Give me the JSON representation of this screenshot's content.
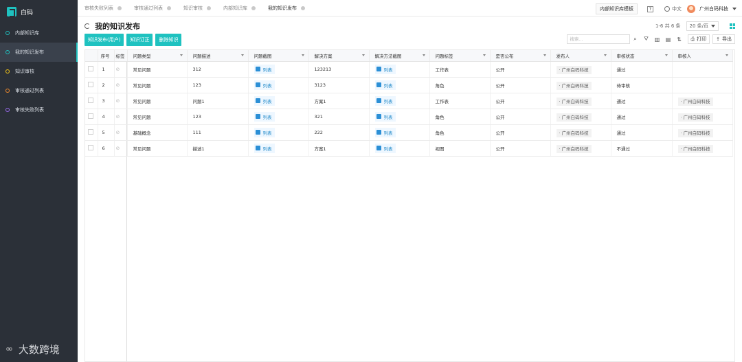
{
  "sidebar": {
    "brand": "白码",
    "items": [
      {
        "label": "内部知识库",
        "color": "#1fc2c0",
        "active": false
      },
      {
        "label": "我的知识发布",
        "color": "#1fc2c0",
        "active": true
      },
      {
        "label": "知识审核",
        "color": "#f5c518",
        "active": false
      },
      {
        "label": "审核通过列表",
        "color": "#f08a2c",
        "active": false
      },
      {
        "label": "审核失败列表",
        "color": "#9b6bf0",
        "active": false
      }
    ],
    "watermark": "大数跨境"
  },
  "tabs": [
    "审核失败列表",
    "审核通过列表",
    "知识审核",
    "内部知识库",
    "我的知识发布"
  ],
  "topbar": {
    "template_btn": "内部知识库模板",
    "help": "?",
    "lang": "中文",
    "company": "广州白码科技"
  },
  "page": {
    "title": "我的知识发布",
    "pager_text": "1-6 共 6 条",
    "page_size": "20 条/页"
  },
  "actions": [
    "知识发布(用户)",
    "知识订正",
    "删除知识"
  ],
  "toolbar": {
    "search_placeholder": "搜索...",
    "print": "打印",
    "export": "导出"
  },
  "table": {
    "fixed_headers": [
      "序号",
      "标签"
    ],
    "headers": [
      "问题类型",
      "问题描述",
      "问题截图",
      "解决方案",
      "解决方法截图",
      "问题标签",
      "是否公布",
      "发布人",
      "审核状态",
      "审核人"
    ],
    "list_label": "列表",
    "rows": [
      {
        "no": "1",
        "type": "常见问题",
        "desc": "312",
        "solution": "123213",
        "label": "工作表",
        "public": "公开",
        "publisher": "· 广州白码科技",
        "status": "通过",
        "reviewer": ""
      },
      {
        "no": "2",
        "type": "常见问题",
        "desc": "123",
        "solution": "3123",
        "label": "角色",
        "public": "公开",
        "publisher": "· 广州白码科技",
        "status": "待审核",
        "reviewer": ""
      },
      {
        "no": "3",
        "type": "常见问题",
        "desc": "问题1",
        "solution": "方案1",
        "label": "工作表",
        "public": "公开",
        "publisher": "· 广州白码科技",
        "status": "通过",
        "reviewer": "· 广州白码科技"
      },
      {
        "no": "4",
        "type": "常见问题",
        "desc": "123",
        "solution": "321",
        "label": "角色",
        "public": "公开",
        "publisher": "· 广州白码科技",
        "status": "通过",
        "reviewer": "· 广州白码科技"
      },
      {
        "no": "5",
        "type": "基础概念",
        "desc": "111",
        "solution": "222",
        "label": "角色",
        "public": "公开",
        "publisher": "· 广州白码科技",
        "status": "通过",
        "reviewer": "· 广州白码科技"
      },
      {
        "no": "6",
        "type": "常见问题",
        "desc": "描述1",
        "solution": "方案1",
        "label": "视图",
        "public": "公开",
        "publisher": "· 广州白码科技",
        "status": "不通过",
        "reviewer": "· 广州白码科技"
      }
    ]
  }
}
